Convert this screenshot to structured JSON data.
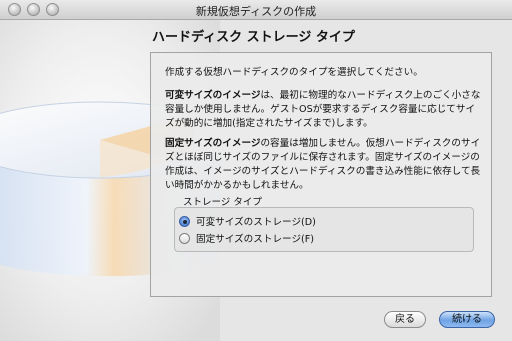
{
  "window": {
    "title": "新規仮想ディスクの作成"
  },
  "page": {
    "title": "ハードディスク ストレージ タイプ"
  },
  "content": {
    "intro": "作成する仮想ハードディスクのタイプを選択してください。",
    "dynamic_heading": "可変サイズのイメージ",
    "dynamic_text": "は、最初に物理的なハードディスク上のごく小さな容量しか使用しません。ゲストOSが要求するディスク容量に応じてサイズが動的に増加(指定されたサイズまで)します。",
    "fixed_heading": "固定サイズのイメージ",
    "fixed_text": "の容量は増加しません。仮想ハードディスクのサイズとほぼ同じサイズのファイルに保存されます。固定サイズのイメージの作成は、イメージのサイズとハードディスクの書き込み性能に依存して長い時間がかかるかもしれません。"
  },
  "storage_type": {
    "label": "ストレージ タイプ",
    "options": [
      {
        "label": "可変サイズのストレージ(D)",
        "selected": true
      },
      {
        "label": "固定サイズのストレージ(F)",
        "selected": false
      }
    ]
  },
  "buttons": {
    "back": "戻る",
    "next": "続ける"
  },
  "colors": {
    "accent": "#5a90dc",
    "window_bg": "#e6e6e6"
  }
}
